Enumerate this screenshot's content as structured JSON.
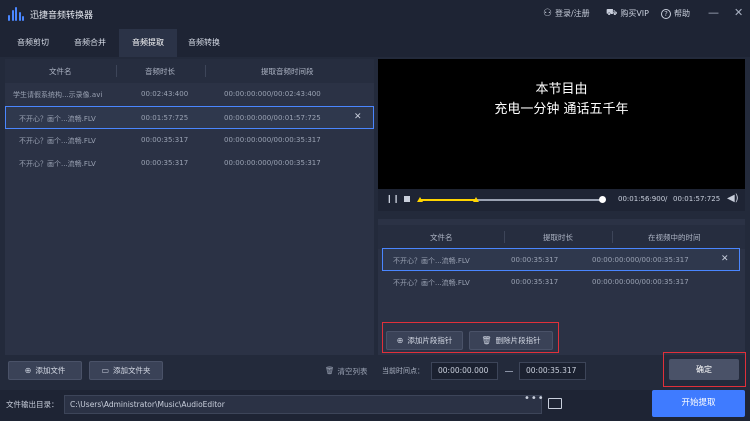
{
  "app": {
    "title": "迅捷音频转换器"
  },
  "titlebar": {
    "login": "登录/注册",
    "buy_vip": "购买VIP",
    "help": "帮助",
    "minimize": "—",
    "close": "✕"
  },
  "tabs": [
    {
      "label": "音频剪切"
    },
    {
      "label": "音频合并"
    },
    {
      "label": "音频提取"
    },
    {
      "label": "音频转换"
    }
  ],
  "file_list": {
    "headers": {
      "name": "文件名",
      "duration": "音频时长",
      "range": "提取音频时间段"
    },
    "rows": [
      {
        "name": "学生请假系统构...示录像.avi",
        "duration": "00:02:43:400",
        "range": "00:00:00:000/00:02:43:400"
      },
      {
        "name": "不开心？画个...流畅.FLV",
        "duration": "00:01:57:725",
        "range": "00:00:00:000/00:01:57:725"
      },
      {
        "name": "不开心？画个...流畅.FLV",
        "duration": "00:00:35:317",
        "range": "00:00:00:000/00:00:35:317"
      },
      {
        "name": "不开心？画个...流畅.FLV",
        "duration": "00:00:35:317",
        "range": "00:00:00:000/00:00:35:317"
      }
    ]
  },
  "left_buttons": {
    "add_file": "添加文件",
    "add_folder": "添加文件夹",
    "clear_list": "清空列表"
  },
  "video": {
    "subtitle_line1": "本节目由",
    "subtitle_line2": "充电一分钟  通话五千年"
  },
  "player": {
    "current_time": "00:01:56:900",
    "total_time": "00:01:57:725",
    "progress": 0.99
  },
  "segments": {
    "headers": {
      "name": "文件名",
      "duration": "提取时长",
      "position": "在视频中的时间"
    },
    "rows": [
      {
        "name": "不开心？画个...流畅.FLV",
        "duration": "00:00:35:317",
        "position": "00:00:00:000/00:00:35:317"
      },
      {
        "name": "不开心？画个...流畅.FLV",
        "duration": "00:00:35:317",
        "position": "00:00:00:000/00:00:35:317"
      }
    ]
  },
  "segment_buttons": {
    "add": "添加片段指针",
    "delete": "删除片段指针"
  },
  "time_range": {
    "label": "当前时间点：",
    "start": "00:00:00.000",
    "end": "00:00:35.317"
  },
  "confirm_label": "确定",
  "output": {
    "label": "文件输出目录：",
    "path": "C:\\Users\\Administrator\\Music\\AudioEditor",
    "browse": "•••"
  },
  "start_label": "开始提取",
  "colors": {
    "accent": "#3f7bff",
    "highlight": "#e0303a",
    "marker": "#ffd400"
  }
}
